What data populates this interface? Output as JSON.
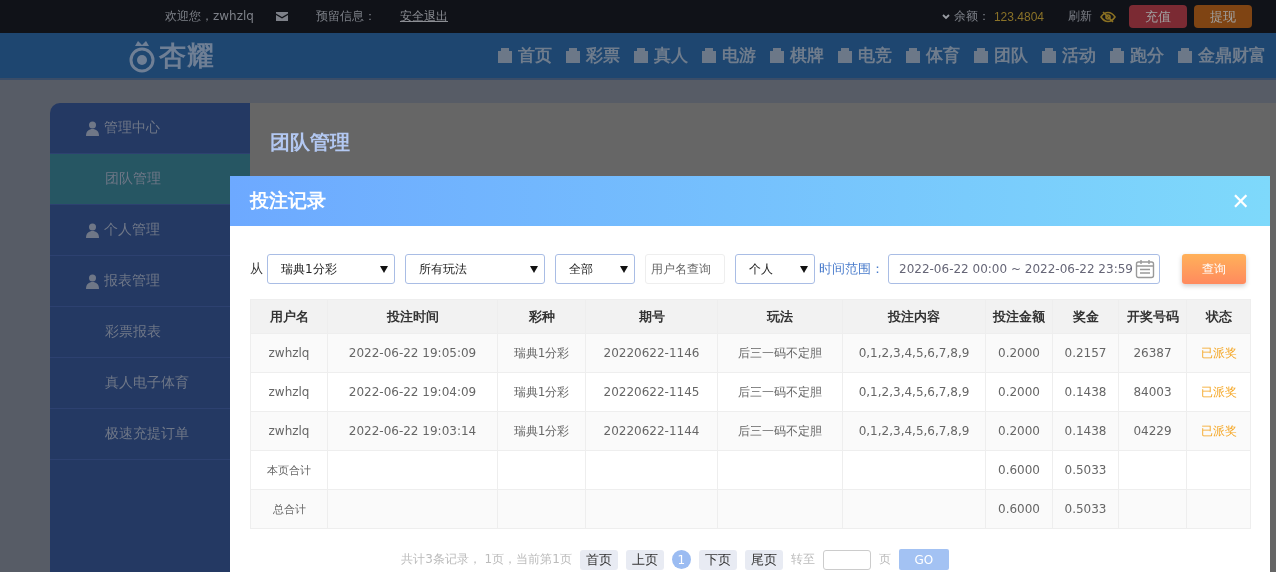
{
  "top_bar": {
    "welcome": "欢迎您，zwhzlq",
    "reserved_label": "预留信息：",
    "logout": "安全退出",
    "balance_label": "余额：",
    "balance": "123.4804",
    "refresh": "刷新",
    "buttons": [
      {
        "label": "充值",
        "kind": "deposit"
      },
      {
        "label": "提现",
        "kind": "withdraw"
      }
    ]
  },
  "logo": "杏耀",
  "nav": [
    {
      "label": "首页"
    },
    {
      "label": "彩票"
    },
    {
      "label": "真人"
    },
    {
      "label": "电游"
    },
    {
      "label": "棋牌"
    },
    {
      "label": "电竞"
    },
    {
      "label": "体育"
    },
    {
      "label": "团队"
    },
    {
      "label": "活动"
    },
    {
      "label": "跑分"
    },
    {
      "label": "金鼎财富"
    }
  ],
  "sidebar": {
    "items": [
      {
        "label": "管理中心",
        "kind": "header",
        "selected": false
      },
      {
        "label": "团队管理",
        "kind": "sub",
        "selected": true
      },
      {
        "label": "个人管理",
        "kind": "header",
        "selected": false
      },
      {
        "label": "报表管理",
        "kind": "header",
        "selected": false
      },
      {
        "label": "彩票报表",
        "kind": "sub",
        "selected": false
      },
      {
        "label": "真人电子体育",
        "kind": "sub",
        "selected": false
      },
      {
        "label": "极速充提订单",
        "kind": "sub",
        "selected": false
      }
    ]
  },
  "page_title": "团队管理",
  "modal": {
    "title": "投注记录",
    "close": "✕",
    "filters": [
      {
        "kind": "label",
        "text": "从"
      },
      {
        "kind": "select",
        "value": "瑞典1分彩"
      },
      {
        "kind": "select",
        "value": "所有玩法"
      },
      {
        "kind": "select",
        "value": "全部"
      },
      {
        "kind": "input",
        "placeholder": "用户名查询"
      },
      {
        "kind": "select",
        "value": "个人"
      },
      {
        "kind": "label_link",
        "text": "时间范围："
      },
      {
        "kind": "date",
        "value": "2022-06-22 00:00 ~ 2022-06-22 23:59"
      },
      {
        "kind": "button",
        "text": "查询"
      }
    ],
    "table": {
      "columns": [
        "用户名",
        "投注时间",
        "彩种",
        "期号",
        "玩法",
        "投注内容",
        "投注金额",
        "奖金",
        "开奖号码",
        "状态"
      ],
      "rows": [
        {
          "kind": "bet",
          "cells": [
            "zwhzlq",
            "2022-06-22 19:05:09",
            "瑞典1分彩",
            "20220622-1146",
            "后三一码不定胆",
            "0,1,2,3,4,5,6,7,8,9",
            "0.2000",
            "0.2157",
            "26387"
          ],
          "status": "已派奖"
        },
        {
          "kind": "bet",
          "cells": [
            "zwhzlq",
            "2022-06-22 19:04:09",
            "瑞典1分彩",
            "20220622-1145",
            "后三一码不定胆",
            "0,1,2,3,4,5,6,7,8,9",
            "0.2000",
            "0.1438",
            "84003"
          ],
          "status": "已派奖"
        },
        {
          "kind": "bet",
          "cells": [
            "zwhzlq",
            "2022-06-22 19:03:14",
            "瑞典1分彩",
            "20220622-1144",
            "后三一码不定胆",
            "0,1,2,3,4,5,6,7,8,9",
            "0.2000",
            "0.1438",
            "04229"
          ],
          "status": "已派奖"
        },
        {
          "kind": "total",
          "label": "本页合计",
          "amount": "0.6000",
          "bonus": "0.5033"
        },
        {
          "kind": "total",
          "label": "总合计",
          "amount": "0.6000",
          "bonus": "0.5033"
        }
      ]
    },
    "pagination": {
      "summary": "共计3条记录， 1页，当前第1页",
      "pages": [
        {
          "label": "首页",
          "kind": "link",
          "selected": false
        },
        {
          "label": "上页",
          "kind": "link",
          "selected": false
        },
        {
          "label": "1",
          "kind": "number",
          "selected": true
        },
        {
          "label": "下页",
          "kind": "link",
          "selected": false
        },
        {
          "label": "尾页",
          "kind": "link",
          "selected": false
        }
      ],
      "goto_label": "转至",
      "page_label": "页",
      "go": "GO"
    }
  }
}
